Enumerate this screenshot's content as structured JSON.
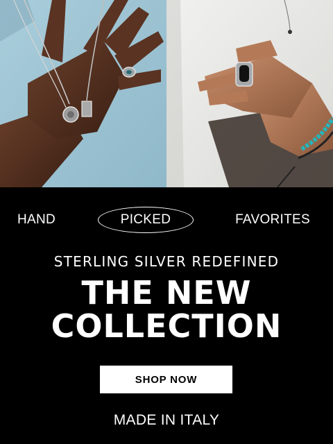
{
  "hero": {
    "left_image": "hand-with-pendant-necklaces-and-ring-photo",
    "right_image": "hand-with-black-stone-ring-and-bead-bracelet-photo"
  },
  "tagline": {
    "left": "HAND",
    "middle": "PICKED",
    "right": "FAVORITES"
  },
  "promo": {
    "kicker": "STERLING SILVER REDEFINED",
    "headline_line1": "THE NEW",
    "headline_line2": "COLLECTION",
    "cta_label": "SHOP NOW",
    "footer": "MADE IN ITALY"
  },
  "colors": {
    "background": "#000000",
    "text": "#ffffff",
    "button_bg": "#ffffff",
    "button_text": "#000000"
  }
}
